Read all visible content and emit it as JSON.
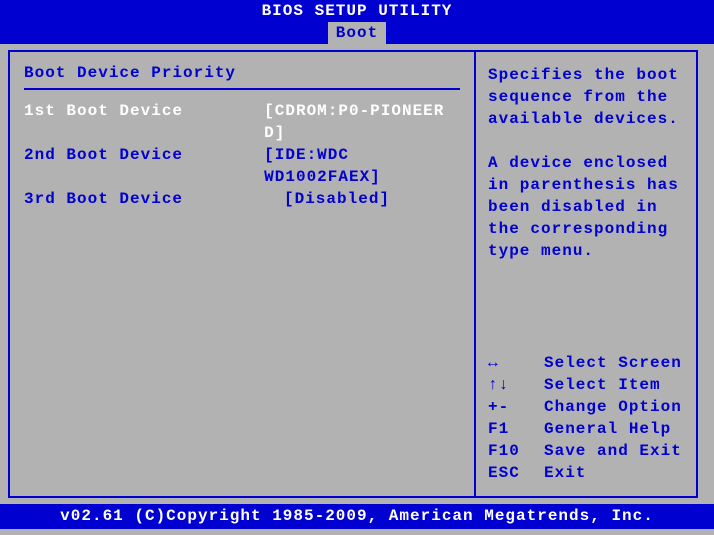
{
  "title": "BIOS SETUP UTILITY",
  "active_tab": "Boot",
  "section_title": "Boot Device Priority",
  "boot_devices": [
    {
      "label": "1st Boot Device",
      "value": "[CDROM:P0-PIONEER D]",
      "selected": true
    },
    {
      "label": "2nd Boot Device",
      "value": "[IDE:WDC WD1002FAEX]",
      "selected": false
    },
    {
      "label": "3rd Boot Device",
      "value": "[Disabled]",
      "selected": false
    }
  ],
  "help": {
    "p1": "Specifies the boot sequence from the available devices.",
    "p2": "A device enclosed in parenthesis has been disabled in the corresponding type menu."
  },
  "keys": [
    {
      "k": "↔",
      "d": "Select Screen"
    },
    {
      "k": "↑↓",
      "d": "Select Item"
    },
    {
      "k": "+-",
      "d": "Change Option"
    },
    {
      "k": "F1",
      "d": "General Help"
    },
    {
      "k": "F10",
      "d": "Save and Exit"
    },
    {
      "k": "ESC",
      "d": "Exit"
    }
  ],
  "footer": "v02.61 (C)Copyright 1985-2009, American Megatrends, Inc."
}
